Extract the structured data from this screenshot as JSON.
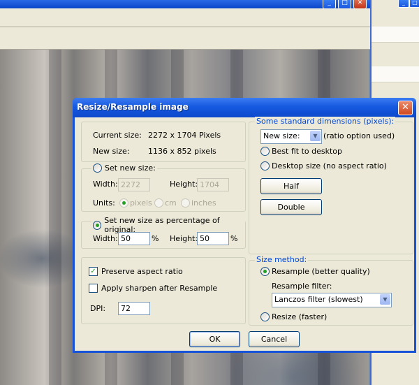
{
  "dialog": {
    "title": "Resize/Resample image",
    "close_glyph": "✕",
    "current_size_label": "Current size:",
    "current_size_value": "2272  x  1704  Pixels",
    "new_size_label": "New size:",
    "new_size_value": "1136  x  852  pixels",
    "set_new_size_label": "Set new size:",
    "width_label": "Width:",
    "width_value": "2272",
    "height_label": "Height:",
    "height_value": "1704",
    "units_label": "Units:",
    "units_options": [
      "pixels",
      "cm",
      "inches"
    ],
    "units_selected": "pixels",
    "percentage_label": "Set new size as percentage of original:",
    "pct_width_label": "Width:",
    "pct_width_value": "50",
    "pct_height_label": "Height:",
    "pct_height_value": "50",
    "percent_sign": "%",
    "preserve_aspect_label": "Preserve aspect ratio",
    "preserve_aspect_checked": true,
    "apply_sharpen_label": "Apply sharpen after Resample",
    "apply_sharpen_checked": false,
    "dpi_label": "DPI:",
    "dpi_value": "72",
    "standard_dims": {
      "legend": "Some standard dimensions (pixels):",
      "select_value": "New size:",
      "select_note": "(ratio option used)",
      "best_fit_label": "Best fit to desktop",
      "desktop_size_label": "Desktop size (no aspect ratio)",
      "half_button": "Half",
      "double_button": "Double"
    },
    "size_method": {
      "legend": "Size method:",
      "resample_label": "Resample (better quality)",
      "filter_label": "Resample filter:",
      "filter_value": "Lanczos filter (slowest)",
      "resize_label": "Resize (faster)",
      "selected": "resample"
    },
    "ok_button": "OK",
    "cancel_button": "Cancel"
  },
  "background": {
    "titlebar_buttons": [
      "_",
      "□",
      "✕"
    ],
    "side_titlebar_buttons": [
      "_",
      "□"
    ]
  },
  "colors": {
    "title_blue": "#0c48cc",
    "dialog_face": "#ece9d8",
    "legend_blue": "#0046d5",
    "radio_dot": "#21a121"
  }
}
